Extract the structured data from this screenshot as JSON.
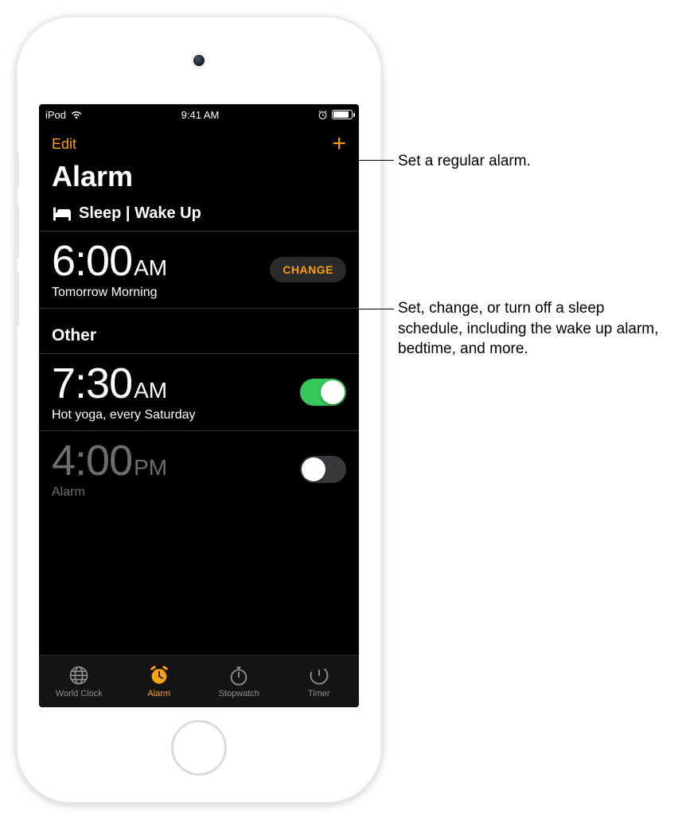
{
  "status": {
    "carrier": "iPod",
    "time": "9:41 AM"
  },
  "nav": {
    "edit": "Edit",
    "add": "+"
  },
  "title": "Alarm",
  "sleep_section": {
    "label": "Sleep | Wake Up",
    "time": "6:00",
    "ampm": "AM",
    "sub": "Tomorrow Morning",
    "change": "CHANGE"
  },
  "other_section": {
    "label": "Other",
    "alarms": [
      {
        "time": "7:30",
        "ampm": "AM",
        "sub": "Hot yoga, every Saturday",
        "on": true
      },
      {
        "time": "4:00",
        "ampm": "PM",
        "sub": "Alarm",
        "on": false
      }
    ]
  },
  "tabs": {
    "world": "World Clock",
    "alarm": "Alarm",
    "stopwatch": "Stopwatch",
    "timer": "Timer"
  },
  "callouts": {
    "c1": "Set a regular alarm.",
    "c2": "Set, change, or turn off a sleep schedule, including the wake up alarm, bedtime, and more."
  }
}
